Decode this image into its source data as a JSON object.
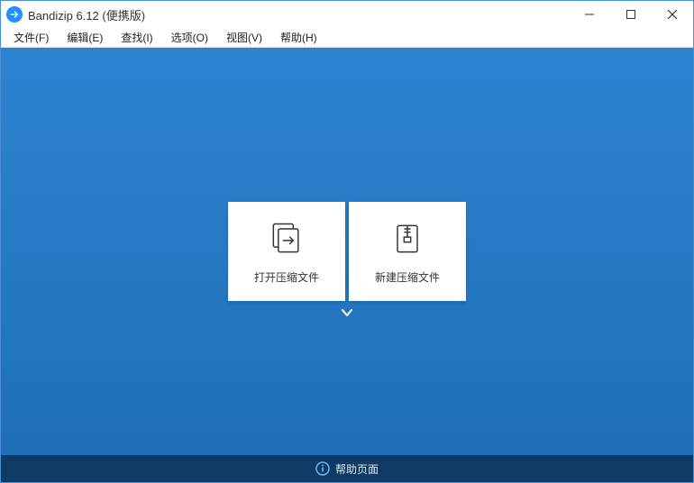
{
  "window": {
    "title": "Bandizip 6.12 (便携版)"
  },
  "menu": {
    "items": [
      {
        "label": "文件(F)"
      },
      {
        "label": "编辑(E)"
      },
      {
        "label": "查找(I)"
      },
      {
        "label": "选项(O)"
      },
      {
        "label": "视图(V)"
      },
      {
        "label": "帮助(H)"
      }
    ]
  },
  "cards": {
    "open": {
      "label": "打开压缩文件"
    },
    "new": {
      "label": "新建压缩文件"
    }
  },
  "statusbar": {
    "help_label": "帮助页面"
  }
}
